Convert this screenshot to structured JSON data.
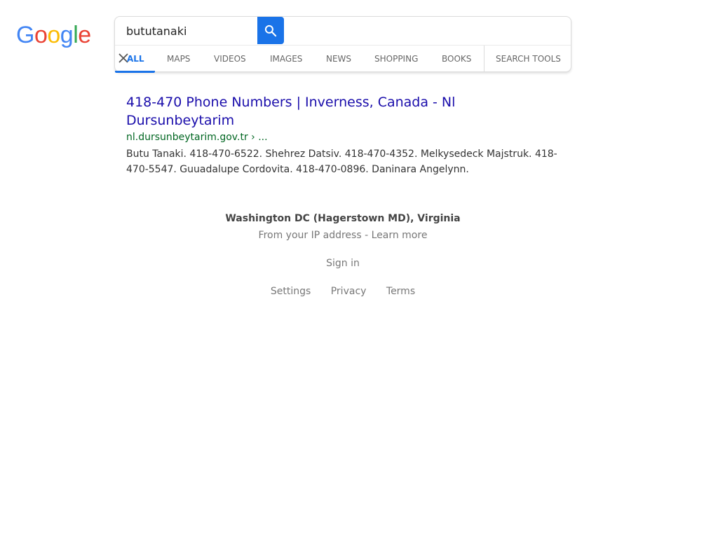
{
  "logo": {
    "letters": [
      "G",
      "o",
      "o",
      "g",
      "l",
      "e"
    ],
    "colors": [
      "#4285F4",
      "#EA4335",
      "#FBBC05",
      "#4285F4",
      "#34A853",
      "#EA4335"
    ]
  },
  "search": {
    "query": "bututanaki",
    "button_icon": "search-icon",
    "accent": "#1a73e8"
  },
  "tabs": [
    {
      "label": "ALL",
      "active": true
    },
    {
      "label": "MAPS"
    },
    {
      "label": "VIDEOS"
    },
    {
      "label": "IMAGES"
    },
    {
      "label": "NEWS"
    },
    {
      "label": "SHOPPING"
    },
    {
      "label": "BOOKS"
    },
    {
      "label": "SEARCH TOOLS"
    }
  ],
  "results": [
    {
      "title": "418-470 Phone Numbers | Inverness, Canada - Nl Dursunbeytarim",
      "url": "nl.dursunbeytarim.gov.tr › ...",
      "snippet": "Butu Tanaki. 418-470-6522. Shehrez Datsiv. 418-470-4352. Melkysedeck Majstruk. 418-470-5547. Guuadalupe Cordovita. 418-470-0896. Daninara Angelynn."
    }
  ],
  "footer": {
    "location": "Washington DC (Hagerstown MD), Virginia",
    "ip_text": "From your IP address - ",
    "learn_more": "Learn more",
    "sign_in": "Sign in",
    "links": [
      "Settings",
      "Privacy",
      "Terms"
    ]
  }
}
